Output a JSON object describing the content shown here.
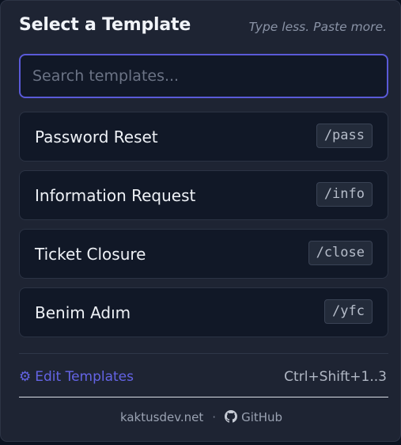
{
  "header": {
    "title": "Select a Template",
    "tagline": "Type less. Paste more."
  },
  "search": {
    "placeholder": "Search templates...",
    "value": ""
  },
  "templates": [
    {
      "name": "Password Reset",
      "shortcut": "/pass"
    },
    {
      "name": "Information Request",
      "shortcut": "/info"
    },
    {
      "name": "Ticket Closure",
      "shortcut": "/close"
    },
    {
      "name": "Benim Adım",
      "shortcut": "/yfc"
    }
  ],
  "footer": {
    "edit_icon": "gear-icon",
    "edit_label": "Edit Templates",
    "hotkey": "Ctrl+Shift+1..3",
    "site_link": "kaktusdev.net",
    "separator": "·",
    "github_icon": "github-icon",
    "github_label": "GitHub"
  },
  "colors": {
    "background": "#1e2433",
    "card": "#111827",
    "accent": "#6464e6",
    "focus_border": "#5a5ad8"
  }
}
